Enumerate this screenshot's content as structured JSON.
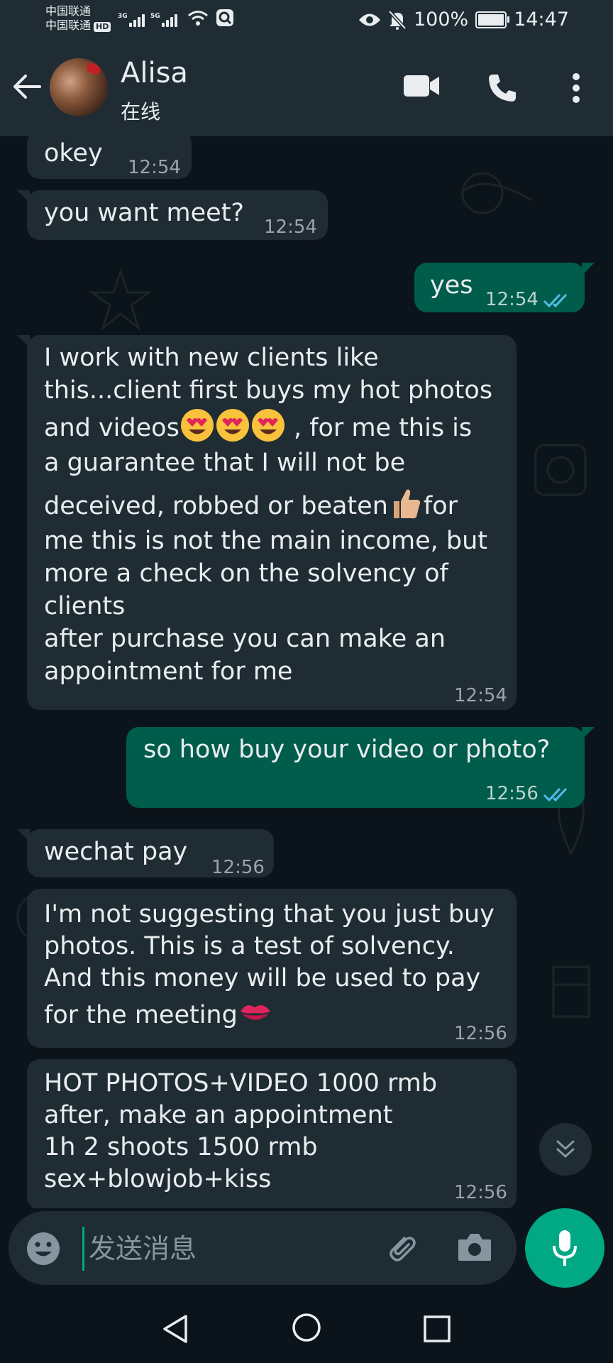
{
  "status_bar": {
    "carrier_1": "中国联通",
    "carrier_2": "中国联通",
    "hd_badge": "HD",
    "net_1": "3G",
    "net_2": "5G",
    "battery_percent": "100%",
    "battery_level": 1.0,
    "time": "14:47"
  },
  "header": {
    "contact_name": "Alisa",
    "contact_status": "在线",
    "icons": [
      "back-arrow-icon",
      "video-call-icon",
      "phone-icon",
      "more-vert-icon"
    ]
  },
  "messages": [
    {
      "direction": "in",
      "text": "okey",
      "time": "12:54"
    },
    {
      "direction": "in",
      "text": "you want meet?",
      "time": "12:54"
    },
    {
      "direction": "out",
      "text": "yes",
      "time": "12:54",
      "read": true
    },
    {
      "direction": "in",
      "lines": [
        "I work with new clients like",
        "this...client first buys my hot photos",
        "and videos[heart-eyes][heart-eyes][heart-eyes] , for me this is",
        "a guarantee that I will not be",
        "deceived, robbed or beaten[thumbs-up]for",
        "me this is not the main income, but",
        "more a check on the solvency of",
        "clients",
        "after purchase you can make an",
        "appointment for me"
      ],
      "time": "12:54"
    },
    {
      "direction": "out",
      "text": "so how buy your video or photo?",
      "time": "12:56",
      "read": true
    },
    {
      "direction": "in",
      "text": "wechat pay",
      "time": "12:56"
    },
    {
      "direction": "in",
      "lines": [
        "I'm not suggesting that you just buy",
        "photos. This is a test of solvency.",
        "And this money will be used to pay",
        "for the meeting[kiss-mark]"
      ],
      "time": "12:56"
    },
    {
      "direction": "in",
      "lines": [
        "HOT PHOTOS+VIDEO 1000 rmb",
        "after, make an appointment",
        "1h 2 shoots 1500 rmb",
        "sex+blowjob+kiss"
      ],
      "time": "12:56"
    }
  ],
  "composer": {
    "placeholder": "发送消息",
    "icons": [
      "emoji-icon",
      "attach-icon",
      "camera-icon",
      "mic-icon"
    ]
  },
  "colors": {
    "background": "#0b141a",
    "bar": "#1f2c34",
    "incoming_bubble": "#202c33",
    "outgoing_bubble": "#005c4b",
    "accent": "#00a884",
    "read_ticks": "#53bdeb"
  }
}
